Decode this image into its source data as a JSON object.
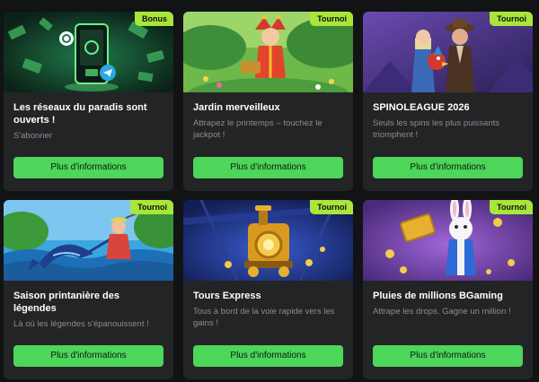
{
  "cards": [
    {
      "badge": "Bonus",
      "title": "Les réseaux du paradis sont ouverts !",
      "desc": "S'abonner",
      "button": "Plus d'informations"
    },
    {
      "badge": "Tournoi",
      "title": "Jardin merveilleux",
      "desc": "Attrapez le printemps – touchez le jackpot !",
      "button": "Plus d'informations"
    },
    {
      "badge": "Tournoi",
      "title": "SPINOLEAGUE 2026",
      "desc": "Seuls les spins les plus puissants triomphent !",
      "button": "Plus d'informations"
    },
    {
      "badge": "Tournoi",
      "title": "Saison printanière des légendes",
      "desc": "Là où les légendes s'épanouissent !",
      "button": "Plus d'informations"
    },
    {
      "badge": "Tournoi",
      "title": "Tours Express",
      "desc": "Tous à bord de la voie rapide vers les gains !",
      "button": "Plus d'informations"
    },
    {
      "badge": "Tournoi",
      "title": "Pluies de millions BGaming",
      "desc": "Attrape les drops. Gagne un million !",
      "button": "Plus d'informations"
    }
  ],
  "colors": {
    "page_bg": "#121315",
    "card_bg": "#232426",
    "badge": "#a8e63a",
    "button": "#4cd65a"
  },
  "icons": [
    "phone-social-icon",
    "telegram-icon",
    "money-bill-icon"
  ]
}
